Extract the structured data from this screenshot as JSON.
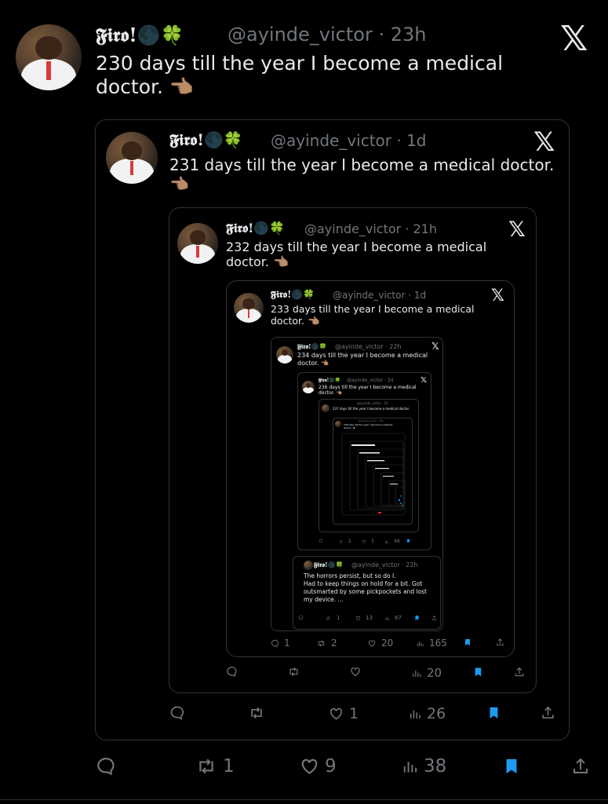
{
  "main": {
    "name": "𝕱𝖎𝖗𝖔!🌑🍀",
    "handle": "@ayinde_victor · 23h",
    "text_line1": "230 days till the year I become a medical",
    "text_line2": "doctor. 👈🏽",
    "actions": {
      "reply": "",
      "retweet": "1",
      "like": "9",
      "views": "38"
    }
  },
  "q1": {
    "name": "𝕱𝖎𝖗𝖔!🌑🍀",
    "handle": "@ayinde_victor · 1d",
    "text_line1": "231 days till the year I become a medical doctor.",
    "text_line2": "👈🏽",
    "actions": {
      "reply": "",
      "retweet": "",
      "like": "1",
      "views": "26"
    }
  },
  "q2": {
    "name": "𝕱𝖎𝖗𝖔!🌑🍀",
    "handle": "@ayinde_victor · 21h",
    "text_line1": "232 days till the year I become a medical",
    "text_line2": "doctor. 👈🏽",
    "actions": {
      "reply": "",
      "retweet": "",
      "like": "",
      "views": "20"
    }
  },
  "q3": {
    "name": "𝕱𝖎𝖗𝖔!🌑🍀",
    "handle": "@ayinde_victor · 1d",
    "text_line1": "233 days till the year I become a medical",
    "text_line2": "doctor. 👈🏽",
    "actions": {
      "reply": "1",
      "retweet": "2",
      "like": "20",
      "views": "165"
    }
  },
  "q4": {
    "name": "𝕱𝖎𝖗𝖔!🌑🍀",
    "handle": "@ayinde_victor · 22h",
    "text_line1": "234 days till the year I become a medical",
    "text_line2": "doctor. 👈🏽"
  },
  "q5": {
    "name": "𝕱𝖎𝖗𝖔!🌑🍀",
    "handle": "@ayinde_victor · 2d",
    "text_line1": "236 days till the year I become a medical",
    "text_line2": "doctor. 👈🏽",
    "actions": {
      "retweet": "2",
      "like": "3",
      "views": "48"
    }
  },
  "q6": {
    "handle": "@ayinde_victor · 2h",
    "text_line1": "237 days till the year I become a medical doctor."
  },
  "q7": {
    "handle": "@ayinde_victor · 22h",
    "text_line1": "238 days till the year I become a medical",
    "text_line2": "doctor. 👈🏽"
  },
  "side_post": {
    "name": "𝕱𝖎𝖗𝖔!🌑🍀",
    "handle": "@ayinde_victor · 22h",
    "line1": "The horrors persist, but so do I.",
    "line2": "Had to keep things on hold for a bit. Got",
    "line3": "outsmarted by some pickpockets and lost",
    "line4": "my device. ...",
    "actions": {
      "retweet": "1",
      "like": "13",
      "views": "67"
    }
  },
  "icons": {
    "close": "x-logo-icon",
    "reply": "reply-icon",
    "retweet": "retweet-icon",
    "like": "heart-icon",
    "views": "views-icon",
    "bookmark": "bookmark-icon",
    "share": "share-icon"
  },
  "colors": {
    "background": "#000000",
    "text": "#e7e9ea",
    "muted": "#71767b",
    "accent": "#1d9bf0",
    "border": "#2f3336"
  }
}
